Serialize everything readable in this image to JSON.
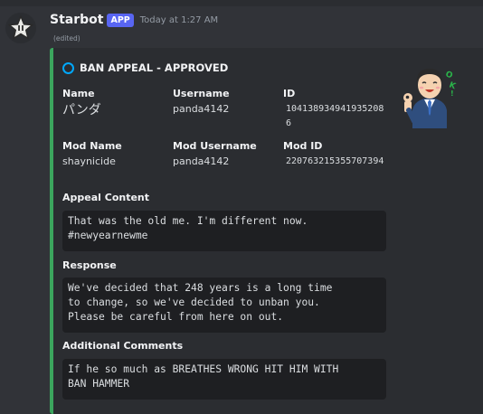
{
  "message": {
    "author": "Starbot",
    "app_badge": "APP",
    "timestamp": "Today at 1:27 AM",
    "edited": "(edited)"
  },
  "colors": {
    "embed_accent": "#3ba55d",
    "title_ring": "#00a8fc",
    "app_badge": "#5865f2"
  },
  "embed": {
    "title": "BAN APPEAL - APPROVED",
    "thumbnail": "ok-gesture-man-illustration",
    "fields": {
      "name": {
        "label": "Name",
        "value": "パンダ"
      },
      "username": {
        "label": "Username",
        "value": "panda4142"
      },
      "id": {
        "label": "ID",
        "value": "1041389349419352086"
      },
      "mod_name": {
        "label": "Mod Name",
        "value": "shaynicide"
      },
      "mod_username": {
        "label": "Mod Username",
        "value": "panda4142"
      },
      "mod_id": {
        "label": "Mod ID",
        "value": "220763215355707394"
      },
      "appeal_content": {
        "label": "Appeal Content",
        "value": "That was the old me. I'm different now.\n#newyearnewme"
      },
      "response": {
        "label": "Response",
        "value": "We've decided that 248 years is a long time\nto change, so we've decided to unban you.\nPlease be careful from here on out."
      },
      "additional_comments": {
        "label": "Additional Comments",
        "value": "If he so much as BREATHES WRONG HIT HIM WITH\nBAN HAMMER"
      }
    }
  }
}
